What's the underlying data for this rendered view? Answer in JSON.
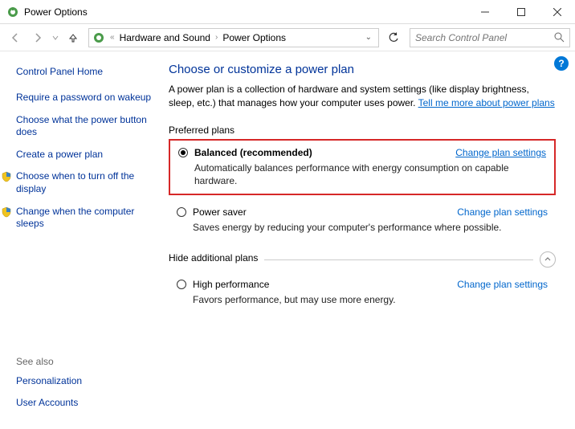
{
  "window": {
    "title": "Power Options"
  },
  "breadcrumb": {
    "ellipsis": "«",
    "part1": "Hardware and Sound",
    "part2": "Power Options"
  },
  "search": {
    "placeholder": "Search Control Panel"
  },
  "sidebar": {
    "home": "Control Panel Home",
    "links": [
      "Require a password on wakeup",
      "Choose what the power button does",
      "Create a power plan",
      "Choose when to turn off the display",
      "Change when the computer sleeps"
    ],
    "seealso_h": "See also",
    "seealso": [
      "Personalization",
      "User Accounts"
    ]
  },
  "main": {
    "heading": "Choose or customize a power plan",
    "desc_pre": "A power plan is a collection of hardware and system settings (like display brightness, sleep, etc.) that manages how your computer uses power. ",
    "desc_link": "Tell me more about power plans",
    "preferred_h": "Preferred plans",
    "hidden_h": "Hide additional plans",
    "plans": [
      {
        "name": "Balanced (recommended)",
        "desc": "Automatically balances performance with energy consumption on capable hardware.",
        "change": "Change plan settings"
      },
      {
        "name": "Power saver",
        "desc": "Saves energy by reducing your computer's performance where possible.",
        "change": "Change plan settings"
      },
      {
        "name": "High performance",
        "desc": "Favors performance, but may use more energy.",
        "change": "Change plan settings"
      }
    ]
  }
}
